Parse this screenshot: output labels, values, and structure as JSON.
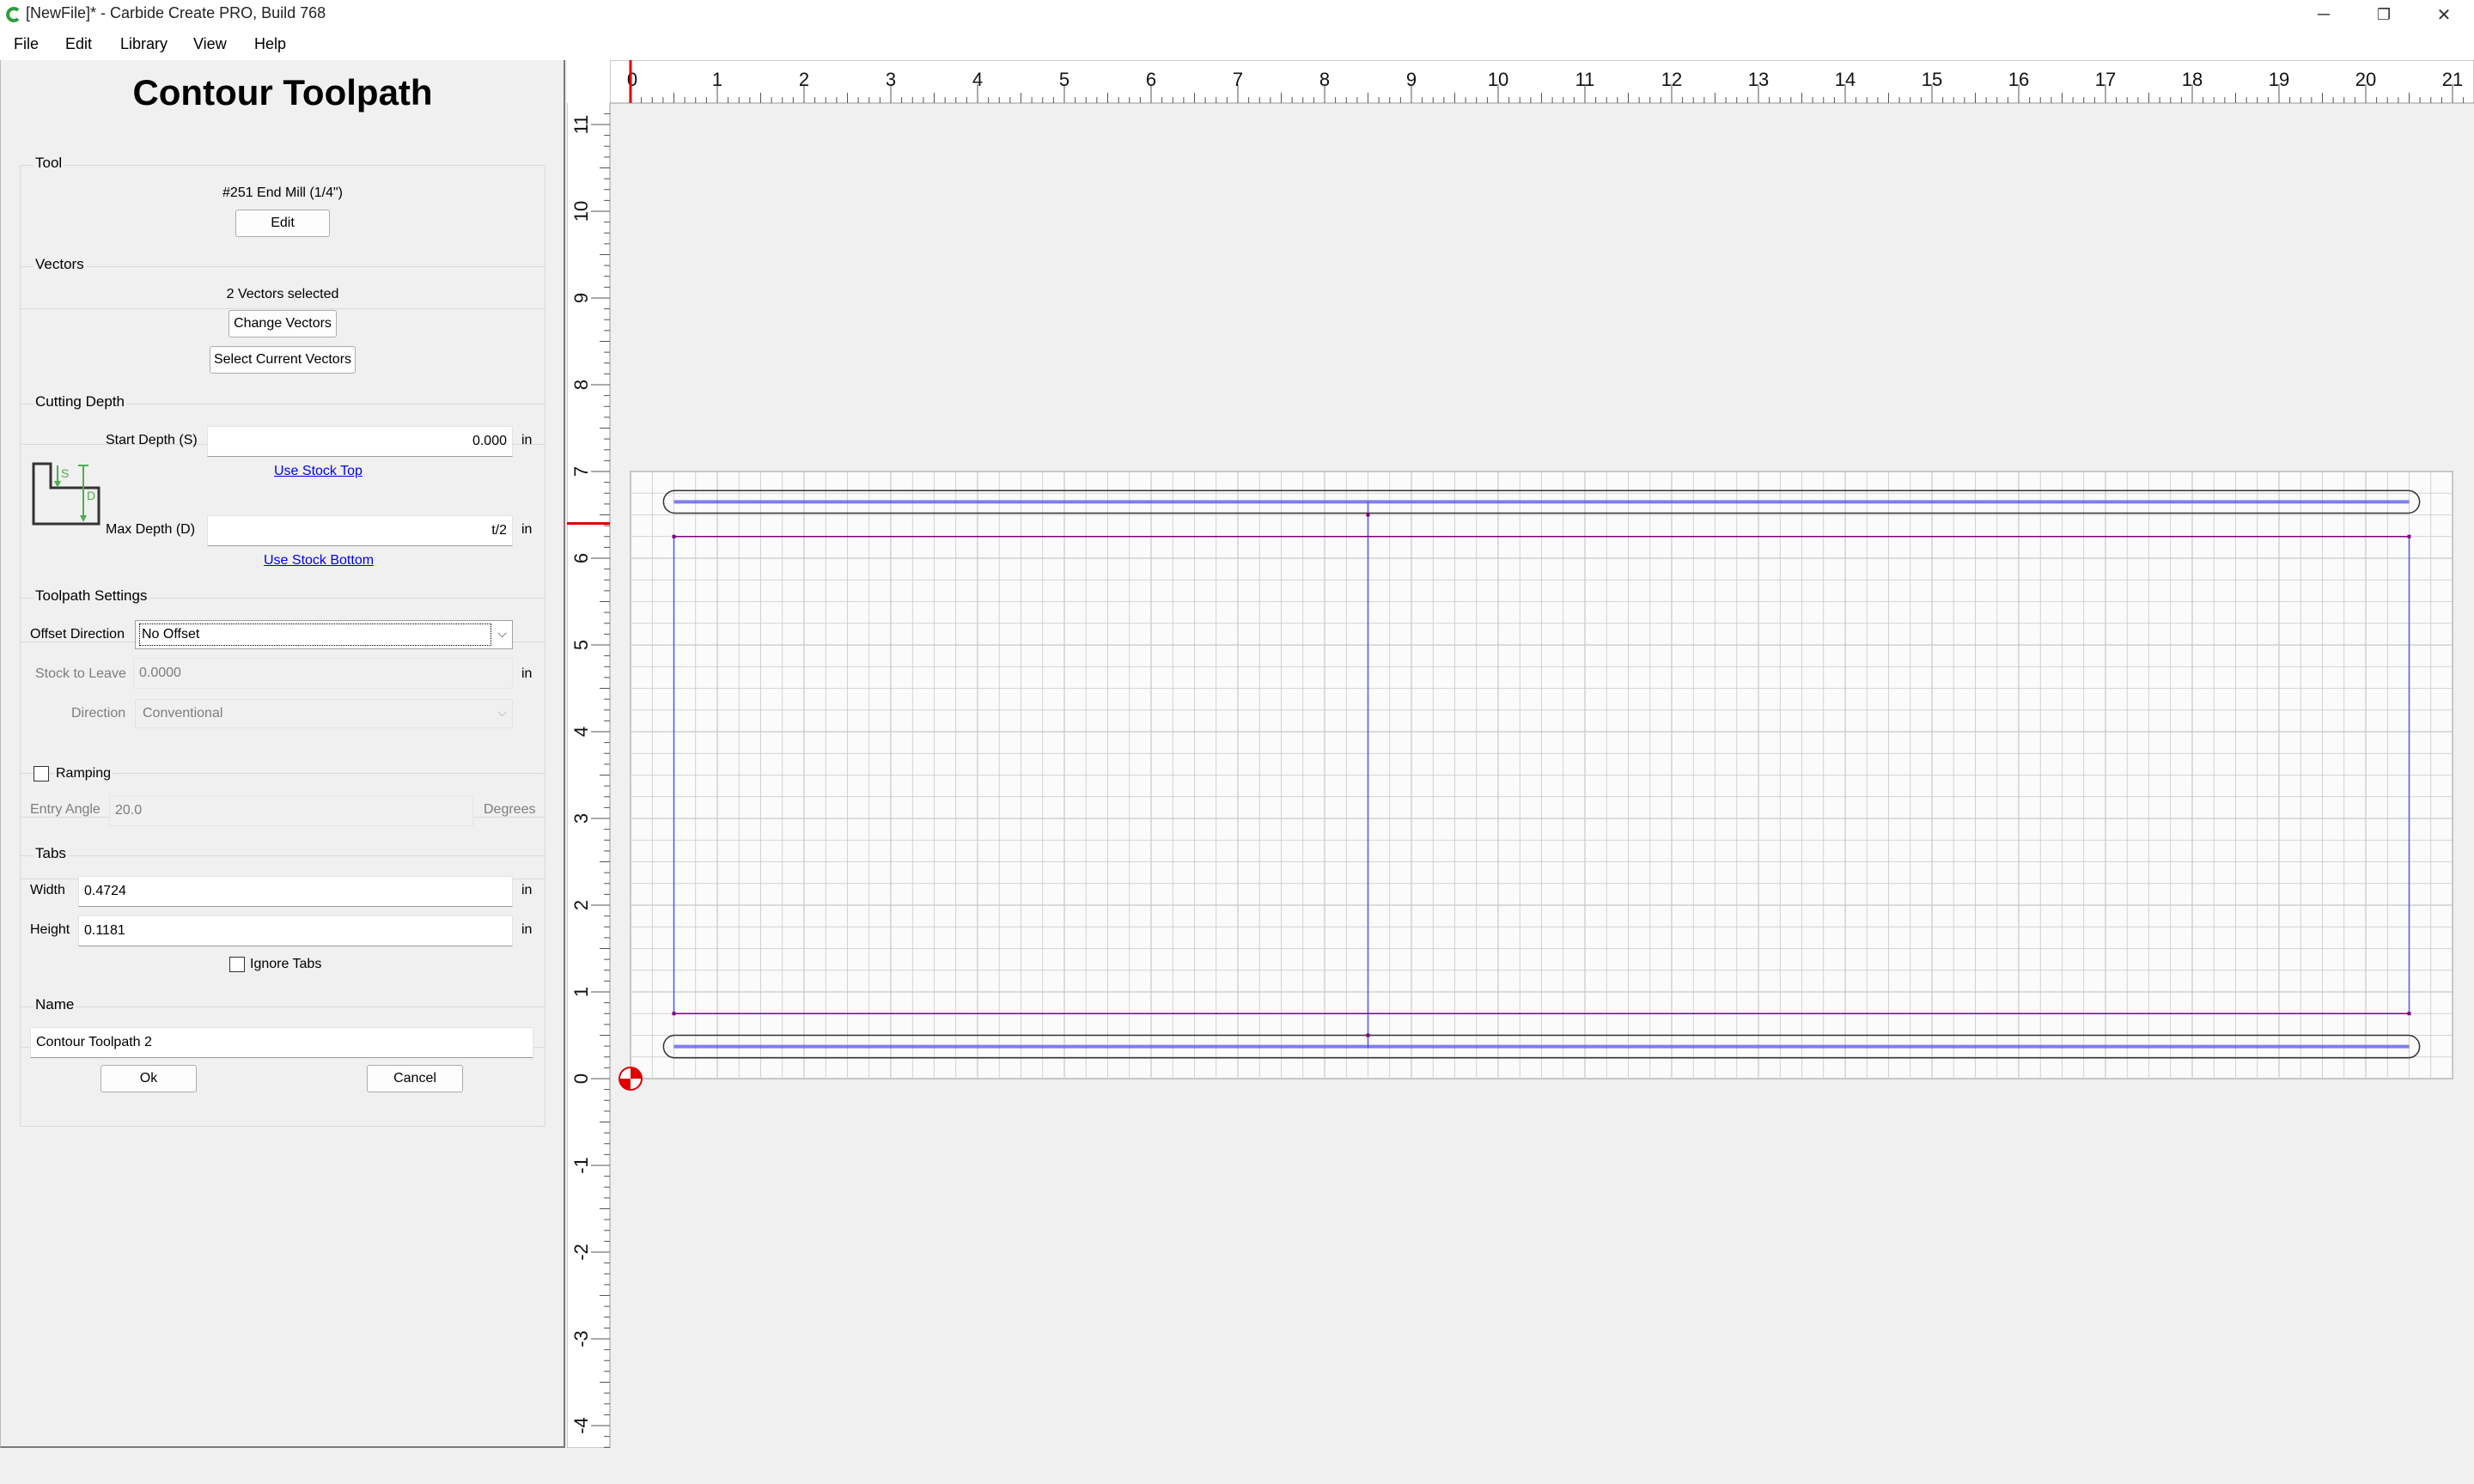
{
  "window": {
    "title": "[NewFile]* - Carbide Create PRO, Build 768",
    "minimize": "─",
    "restore": "❐",
    "close": "✕"
  },
  "menu": {
    "file": "File",
    "edit": "Edit",
    "library": "Library",
    "view": "View",
    "help": "Help"
  },
  "panel": {
    "title": "Contour Toolpath",
    "tool": {
      "group_label": "Tool",
      "name": "#251 End Mill (1/4\")",
      "edit_button": "Edit"
    },
    "vectors": {
      "group_label": "Vectors",
      "selected_text": "2 Vectors selected",
      "change_button": "Change Vectors",
      "select_button": "Select Current Vectors"
    },
    "cutting_depth": {
      "group_label": "Cutting Depth",
      "start_label": "Start Depth (S)",
      "start_value": "0.000",
      "start_unit": "in",
      "use_stock_top": "Use Stock Top",
      "max_label": "Max Depth (D)",
      "max_value": "t/2",
      "max_unit": "in",
      "use_stock_bottom": "Use Stock Bottom",
      "diagram_s": "S",
      "diagram_d": "D"
    },
    "toolpath_settings": {
      "group_label": "Toolpath Settings",
      "offset_label": "Offset Direction",
      "offset_value": "No Offset",
      "stock_label": "Stock to Leave",
      "stock_value": "0.0000",
      "stock_unit": "in",
      "direction_label": "Direction",
      "direction_value": "Conventional"
    },
    "ramping": {
      "label": "Ramping",
      "checked": false,
      "entry_angle_label": "Entry Angle",
      "entry_angle_value": "20.0",
      "entry_angle_unit": "Degrees"
    },
    "tabs": {
      "group_label": "Tabs",
      "width_label": "Width",
      "width_value": "0.4724",
      "width_unit": "in",
      "height_label": "Height",
      "height_value": "0.1181",
      "height_unit": "in",
      "ignore_label": "Ignore Tabs",
      "ignore_checked": false
    },
    "name": {
      "group_label": "Name",
      "value": "Contour Toolpath 2"
    },
    "ok_button": "Ok",
    "cancel_button": "Cancel"
  },
  "canvas": {
    "ruler_top_labels": [
      "0",
      "1",
      "2",
      "3",
      "4",
      "5",
      "6",
      "7",
      "8",
      "9",
      "10",
      "11",
      "12",
      "13",
      "14",
      "15",
      "16",
      "17",
      "18",
      "19",
      "20",
      "21"
    ],
    "ruler_left_labels": [
      "11",
      "10",
      "9",
      "8",
      "7",
      "6",
      "5",
      "4",
      "3",
      "2",
      "1",
      "0",
      "-1",
      "-2",
      "-3",
      "-4"
    ],
    "stock_width": 21,
    "stock_height": 7,
    "colors": {
      "grid": "#c8c8c8",
      "vector": "#5555ee",
      "toolpath": "#800080",
      "origin": "#e00000",
      "stock_fill": "#fbfbfb"
    }
  }
}
